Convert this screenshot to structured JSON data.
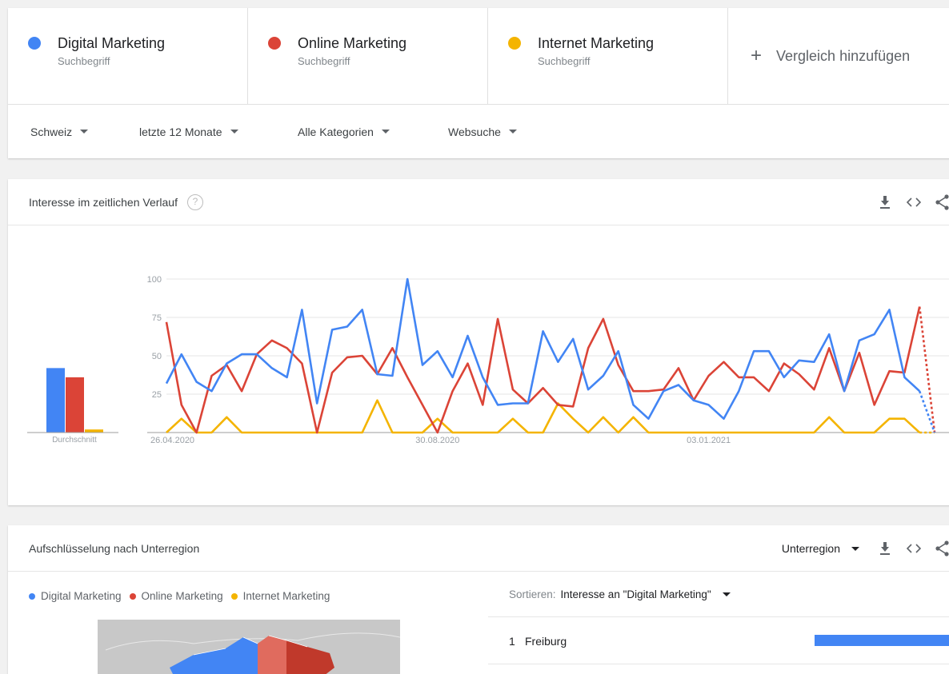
{
  "compare": {
    "terms": [
      {
        "name": "Digital Marketing",
        "sub": "Suchbegriff",
        "color": "#4285f4"
      },
      {
        "name": "Online Marketing",
        "sub": "Suchbegriff",
        "color": "#db4437"
      },
      {
        "name": "Internet Marketing",
        "sub": "Suchbegriff",
        "color": "#f4b400"
      }
    ],
    "add_plus": "+",
    "add_label": "Vergleich hinzufügen"
  },
  "filters": {
    "region": "Schweiz",
    "time": "letzte 12 Monate",
    "category": "Alle Kategorien",
    "search_type": "Websuche"
  },
  "interest": {
    "title": "Interesse im zeitlichen Verlauf",
    "help": "?",
    "icons": [
      "download-icon",
      "embed-icon",
      "share-icon"
    ]
  },
  "chart_data": {
    "type": "line",
    "ylim": [
      0,
      100
    ],
    "yticks": [
      "100",
      "75",
      "50",
      "25"
    ],
    "xticks": [
      "26.04.2020",
      "30.08.2020",
      "03.01.2021"
    ],
    "avg_label": "Durchschnitt",
    "averages": [
      42,
      36,
      2
    ],
    "grid": true,
    "last_point_partial": true,
    "series": [
      {
        "name": "Digital Marketing",
        "color": "#4285f4",
        "values": [
          32,
          51,
          33,
          27,
          45,
          51,
          51,
          42,
          36,
          80,
          19,
          67,
          69,
          80,
          38,
          37,
          100,
          44,
          53,
          36,
          63,
          36,
          18,
          19,
          19,
          66,
          46,
          61,
          28,
          37,
          53,
          18,
          9,
          27,
          31,
          21,
          18,
          9,
          27,
          53,
          53,
          36,
          47,
          46,
          64,
          27,
          60,
          64,
          80,
          36,
          27,
          0
        ]
      },
      {
        "name": "Online Marketing",
        "color": "#db4437",
        "values": [
          72,
          18,
          0,
          37,
          44,
          27,
          51,
          60,
          55,
          45,
          0,
          39,
          49,
          50,
          38,
          55,
          36,
          18,
          0,
          27,
          45,
          18,
          74,
          28,
          19,
          29,
          18,
          17,
          55,
          74,
          44,
          27,
          27,
          28,
          42,
          21,
          37,
          46,
          36,
          36,
          27,
          45,
          38,
          28,
          55,
          27,
          52,
          18,
          40,
          39,
          82,
          0
        ]
      },
      {
        "name": "Internet Marketing",
        "color": "#f4b400",
        "values": [
          0,
          9,
          0,
          0,
          10,
          0,
          0,
          0,
          0,
          0,
          0,
          0,
          0,
          0,
          21,
          0,
          0,
          0,
          9,
          0,
          0,
          0,
          0,
          9,
          0,
          0,
          19,
          9,
          0,
          10,
          0,
          10,
          0,
          0,
          0,
          0,
          0,
          0,
          0,
          0,
          0,
          0,
          0,
          0,
          10,
          0,
          0,
          0,
          9,
          9,
          0,
          0
        ]
      }
    ]
  },
  "subregion": {
    "title": "Aufschlüsselung nach Unterregion",
    "granularity": "Unterregion",
    "legend": [
      "Digital Marketing",
      "Online Marketing",
      "Internet Marketing"
    ],
    "sort_label": "Sortieren:",
    "sort_value": "Interesse an \"Digital Marketing\"",
    "rows": [
      {
        "rank": "1",
        "name": "Freiburg",
        "value": 100
      }
    ]
  }
}
